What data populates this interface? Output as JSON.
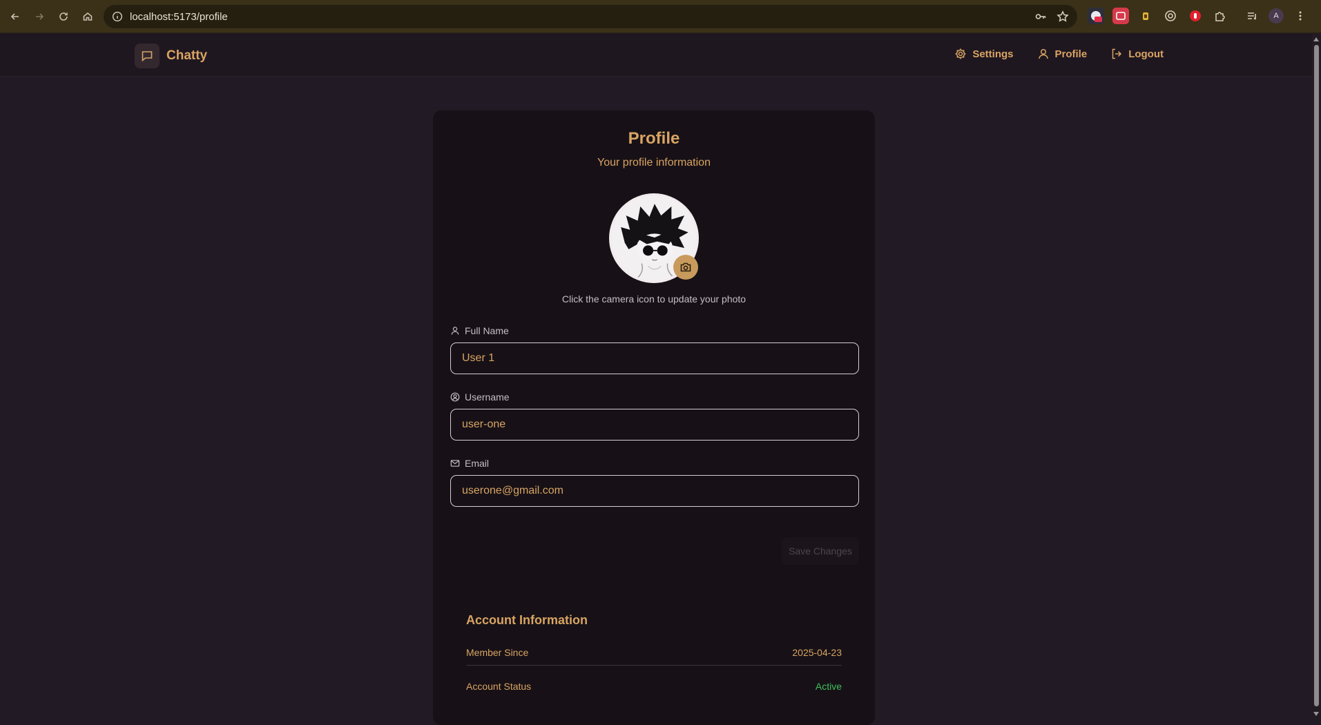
{
  "browser": {
    "url": "localhost:5173/profile"
  },
  "nav": {
    "brand": "Chatty",
    "links": [
      {
        "label": "Settings",
        "icon": "gear-icon"
      },
      {
        "label": "Profile",
        "icon": "user-icon"
      },
      {
        "label": "Logout",
        "icon": "logout-icon"
      }
    ]
  },
  "profile": {
    "title": "Profile",
    "subtitle": "Your profile information",
    "avatar_hint": "Click the camera icon to update your photo"
  },
  "fields": {
    "full_name": {
      "label": "Full Name",
      "value": "User 1"
    },
    "username": {
      "label": "Username",
      "value": "user-one"
    },
    "email": {
      "label": "Email",
      "value": "userone@gmail.com"
    }
  },
  "actions": {
    "save_label": "Save Changes"
  },
  "account": {
    "title": "Account Information",
    "member_since_label": "Member Since",
    "member_since_value": "2025-04-23",
    "status_label": "Account Status",
    "status_value": "Active"
  },
  "colors": {
    "accent": "#d9a463",
    "background": "#221a24",
    "card": "#171117",
    "active": "#3fbf5a"
  }
}
